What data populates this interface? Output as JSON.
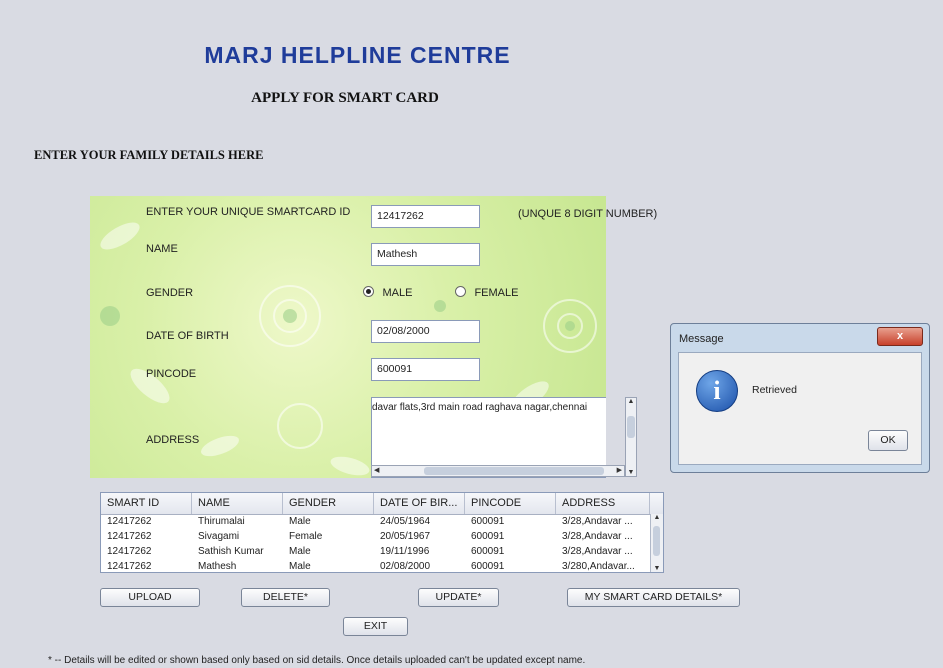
{
  "header": {
    "title": "MARJ HELPLINE CENTRE",
    "subtitle": "APPLY FOR SMART CARD",
    "section": "ENTER YOUR FAMILY DETAILS HERE"
  },
  "form": {
    "smartcard_label": "ENTER YOUR UNIQUE SMARTCARD ID",
    "smartcard_value": "12417262",
    "smartcard_hint": "(UNQUE 8 DIGIT NUMBER)",
    "name_label": "NAME",
    "name_value": "Mathesh",
    "gender_label": "GENDER",
    "gender_male": "MALE",
    "gender_female": "FEMALE",
    "gender_selected": "MALE",
    "dob_label": "DATE OF BIRTH",
    "dob_value": "02/08/2000",
    "pincode_label": "PINCODE",
    "pincode_value": "600091",
    "address_label": "ADDRESS",
    "address_value": "davar flats,3rd main road raghava nagar,chennai"
  },
  "table": {
    "columns": [
      "SMART ID",
      "NAME",
      "GENDER",
      "DATE OF BIR...",
      "PINCODE",
      "ADDRESS"
    ],
    "rows": [
      [
        "12417262",
        "Thirumalai",
        "Male",
        "24/05/1964",
        "600091",
        "3/28,Andavar ..."
      ],
      [
        "12417262",
        "Sivagami",
        "Female",
        "20/05/1967",
        "600091",
        "3/28,Andavar ..."
      ],
      [
        "12417262",
        "Sathish Kumar",
        "Male",
        "19/11/1996",
        "600091",
        "3/28,Andavar ..."
      ],
      [
        "12417262",
        "Mathesh",
        "Male",
        "02/08/2000",
        "600091",
        "3/280,Andavar..."
      ]
    ]
  },
  "buttons": {
    "upload": "UPLOAD",
    "delete": "DELETE*",
    "update": "UPDATE*",
    "details": "MY SMART CARD DETAILS*",
    "exit": "EXIT"
  },
  "dialog": {
    "title": "Message",
    "message": "Retrieved",
    "ok": "OK",
    "close": "x"
  },
  "footnote": "* -- Details will be edited or shown based only based on sid details. Once details uploaded can't be updated except name."
}
